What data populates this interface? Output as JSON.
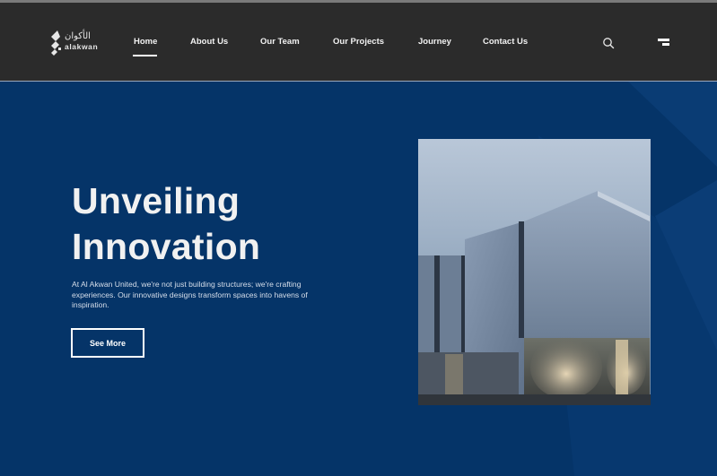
{
  "brand": {
    "logo_arabic": "الأكوان",
    "logo_latin": "alakwan",
    "icon": "brand-logo-mark"
  },
  "nav": {
    "items": [
      {
        "label": "Home",
        "active": true
      },
      {
        "label": "About Us",
        "active": false
      },
      {
        "label": "Our Team",
        "active": false
      },
      {
        "label": "Our Projects",
        "active": false
      },
      {
        "label": "Journey",
        "active": false
      },
      {
        "label": "Contact Us",
        "active": false
      }
    ],
    "search_icon": "search-icon",
    "menu_icon": "menu-icon"
  },
  "hero": {
    "title_line1": "Unveiling",
    "title_line2": "Innovation",
    "description": "At Al Akwan United, we're not just building structures; we're crafting experiences. Our innovative designs transform spaces into havens of inspiration.",
    "button_label": "See More",
    "image": "modern-building-photo"
  },
  "colors": {
    "navbar_bg": "#2b2b2b",
    "hero_bg": "#053468",
    "text": "#f1f1f1"
  }
}
